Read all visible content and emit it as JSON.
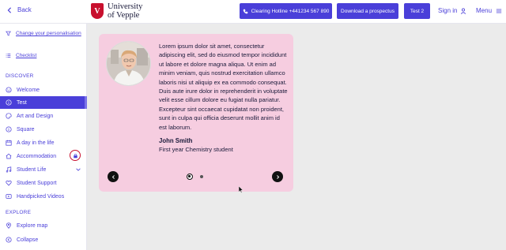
{
  "header": {
    "back_label": "Back",
    "logo": {
      "line1": "University",
      "line2": "of Vepple",
      "mark": "V",
      "brand_color": "#c8102e"
    },
    "buttons": [
      {
        "label": "Clearing Hotline +441234 567 890",
        "icon": "phone-icon"
      },
      {
        "label": "Download a prospectus"
      },
      {
        "label": "Test 2"
      }
    ],
    "sign_in_label": "Sign in",
    "menu_label": "Menu"
  },
  "sidebar": {
    "links": [
      {
        "label": "Change your personalisation",
        "icon": "filter-icon"
      },
      {
        "label": "Checklist",
        "icon": "list-icon"
      }
    ],
    "discover_title": "DISCOVER",
    "items": [
      {
        "label": "Welcome",
        "icon": "smile-icon"
      },
      {
        "label": "Test",
        "icon": "info-icon",
        "active": true
      },
      {
        "label": "Art and Design",
        "icon": "palette-icon"
      },
      {
        "label": "Square",
        "icon": "info-icon"
      },
      {
        "label": "A day in the life",
        "icon": "calendar-icon"
      },
      {
        "label": "Accommodation",
        "icon": "home-icon",
        "locked": true
      },
      {
        "label": "Student Life",
        "icon": "music-icon",
        "expandable": true
      },
      {
        "label": "Student Support",
        "icon": "heart-icon"
      },
      {
        "label": "Handpicked Videos",
        "icon": "video-icon"
      }
    ],
    "explore_title": "EXPLORE",
    "explore_items": [
      {
        "label": "Explore map",
        "icon": "map-pin-icon"
      },
      {
        "label": "Collapse",
        "icon": "collapse-icon"
      }
    ]
  },
  "testimonial": {
    "quote": "Lorem ipsum dolor sit amet, consectetur adipiscing elit, sed do eiusmod tempor incididunt ut labore et dolore magna aliqua. Ut enim ad minim veniam, quis nostrud exercitation ullamco laboris nisi ut aliquip ex ea commodo consequat. Duis aute irure dolor in reprehenderit in voluptate velit esse cillum dolore eu fugiat nulla pariatur. Excepteur sint occaecat cupidatat non proident, sunt in culpa qui officia deserunt mollit anim id est laborum.",
    "name": "John Smith",
    "role": "First year Chemistry student",
    "slides": 2,
    "active_slide": 1,
    "card_color": "#f6cde0"
  },
  "colors": {
    "accent": "#4a3fd9",
    "brand": "#c8102e"
  }
}
